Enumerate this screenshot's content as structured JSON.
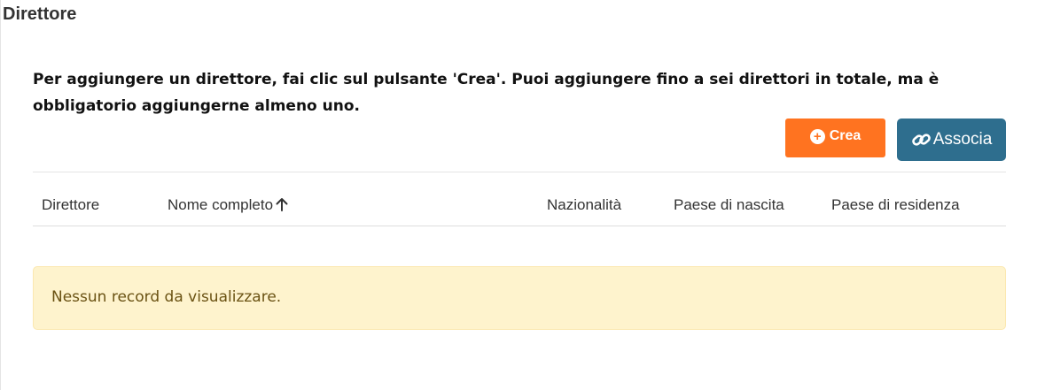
{
  "section": {
    "title": "Direttore",
    "instructions": "Per aggiungere un direttore, fai clic sul pulsante 'Crea'. Puoi aggiungere fino a sei direttori in totale, ma è obbligatorio aggiungerne almeno uno."
  },
  "actions": {
    "create_label": "Crea",
    "create_icon": "plus-circle-icon",
    "create_color": "#ff7320",
    "associate_label": "Associa",
    "associate_icon": "link-icon",
    "associate_color": "#2e6e8e"
  },
  "table": {
    "columns": [
      {
        "label": "Direttore"
      },
      {
        "label": "Nome completo",
        "sort": "ascending",
        "sort_icon": "arrow-up-icon"
      },
      {
        "label": "Nazionalità"
      },
      {
        "label": "Paese di nascita"
      },
      {
        "label": "Paese di residenza"
      }
    ],
    "empty_message": "Nessun record da visualizzare.",
    "empty_color": "#fef3cd"
  }
}
